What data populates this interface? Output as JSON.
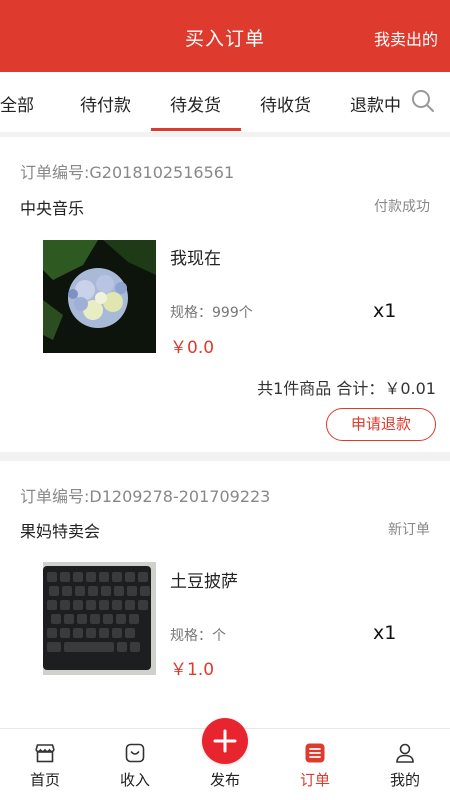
{
  "header": {
    "title": "买入订单",
    "right_link": "我卖出的"
  },
  "tabs": [
    "全部",
    "待付款",
    "待发货",
    "待收货",
    "退款中"
  ],
  "active_tab": "待发货",
  "orders": [
    {
      "order_no": "订单编号:G2018102516561",
      "shop": "中央音乐",
      "status": "付款成功",
      "image_icon": "hydrangea-photo",
      "product_name": "我现在",
      "spec": "规格：999个",
      "price": "￥0.0",
      "qty": "x1",
      "total": "共1件商品 合计：￥0.01",
      "refund_label": "申请退款"
    },
    {
      "order_no": "订单编号:D1209278-201709223",
      "shop": "果妈特卖会",
      "status": "新订单",
      "image_icon": "keyboard-photo",
      "product_name": "土豆披萨",
      "spec": "规格：个",
      "price": "￥1.0",
      "qty": "x1"
    }
  ],
  "tabbar": {
    "home": "首页",
    "income": "收入",
    "publish": "发布",
    "orders": "订单",
    "mine": "我的",
    "active": "订单"
  },
  "colors": {
    "accent": "#de3a2d",
    "publish": "#e8242f"
  }
}
